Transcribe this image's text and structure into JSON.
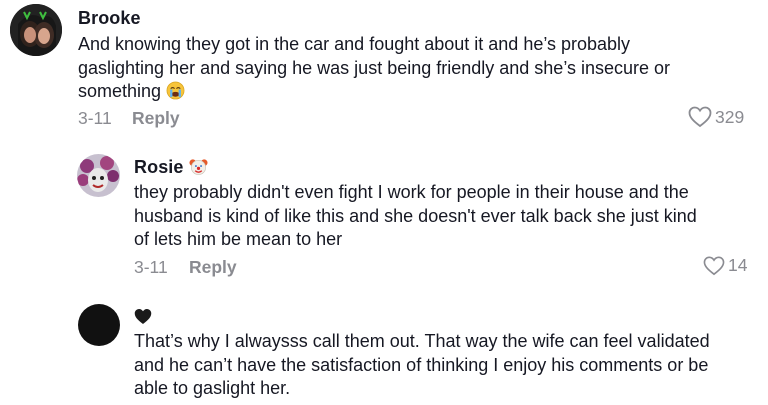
{
  "comments": [
    {
      "username": "Brooke",
      "text_lines": [
        "And knowing they got in the car and fought about it and he’s probably",
        "gaslighting her and saying he was just being friendly and she’s insecure or",
        "something"
      ],
      "date": "3-11",
      "reply_label": "Reply",
      "likes": "329",
      "trailing_emoji": "crying-face"
    },
    {
      "username": "Rosie",
      "username_emoji": "clown-face",
      "text_lines": [
        "they probably didn't even fight I work for people in their house and the",
        "husband is kind of like this and she doesn't ever talk back she just kind",
        "of lets him be mean to her"
      ],
      "date": "3-11",
      "reply_label": "Reply",
      "likes": "14"
    },
    {
      "username_emoji": "black-heart",
      "text_lines": [
        "That’s why I alwaysss call them out. That way the wife can feel validated",
        "and he can’t have the satisfaction of thinking I enjoy his comments or be",
        "able to gaslight her."
      ]
    }
  ],
  "colors": {
    "text": "#161823",
    "secondary": "#8a8b91",
    "background": "#ffffff"
  }
}
